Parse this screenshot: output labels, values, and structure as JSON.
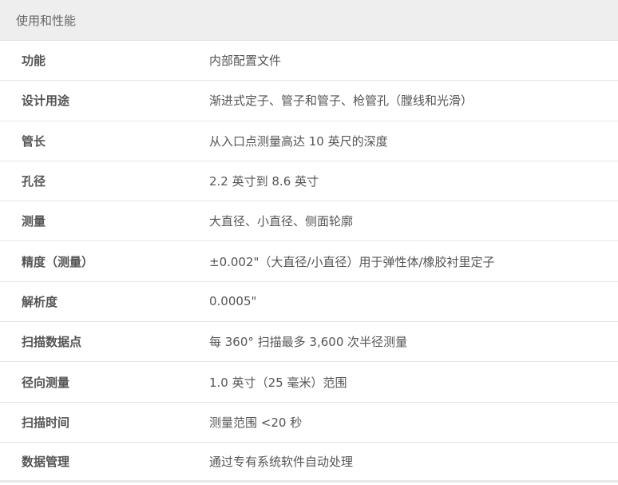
{
  "header": {
    "title": "使用和性能"
  },
  "rows": [
    {
      "label": "功能",
      "value": "内部配置文件"
    },
    {
      "label": "设计用途",
      "value": "渐进式定子、管子和管子、枪管孔（膛线和光滑）"
    },
    {
      "label": "管长",
      "value": "从入口点测量高达 10 英尺的深度"
    },
    {
      "label": "孔径",
      "value": "2.2 英寸到 8.6 英寸"
    },
    {
      "label": "测量",
      "value": "大直径、小直径、侧面轮廓"
    },
    {
      "label": "精度（测量）",
      "value": "±0.002\"（大直径/小直径）用于弹性体/橡胶衬里定子"
    },
    {
      "label": "解析度",
      "value": "0.0005\""
    },
    {
      "label": "扫描数据点",
      "value": "每 360° 扫描最多 3,600 次半径测量"
    },
    {
      "label": "径向测量",
      "value": "1.0 英寸（25 毫米）范围"
    },
    {
      "label": "扫描时间",
      "value": "测量范围 <20 秒"
    },
    {
      "label": "数据管理",
      "value": "通过专有系统软件自动处理"
    }
  ]
}
